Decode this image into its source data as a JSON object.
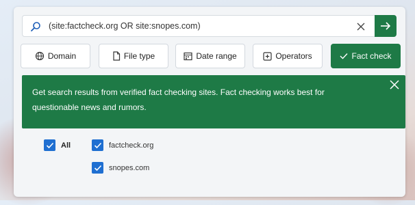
{
  "search": {
    "query": "(site:factcheck.org OR site:snopes.com)"
  },
  "filters": [
    {
      "label": "Domain",
      "icon": "domain-icon"
    },
    {
      "label": "File type",
      "icon": "file-icon"
    },
    {
      "label": "Date range",
      "icon": "calendar-icon"
    },
    {
      "label": "Operators",
      "icon": "operators-icon"
    },
    {
      "label": "Fact check",
      "icon": "check-icon",
      "active": true
    }
  ],
  "banner": {
    "text": "Get search results from verified fact checking sites. Fact checking works best for questionable news and rumors."
  },
  "options": {
    "all_label": "All",
    "sites": [
      "factcheck.org",
      "snopes.com"
    ]
  },
  "colors": {
    "accent_green": "#1e7a46",
    "checkbox_blue": "#1f6fd1"
  }
}
